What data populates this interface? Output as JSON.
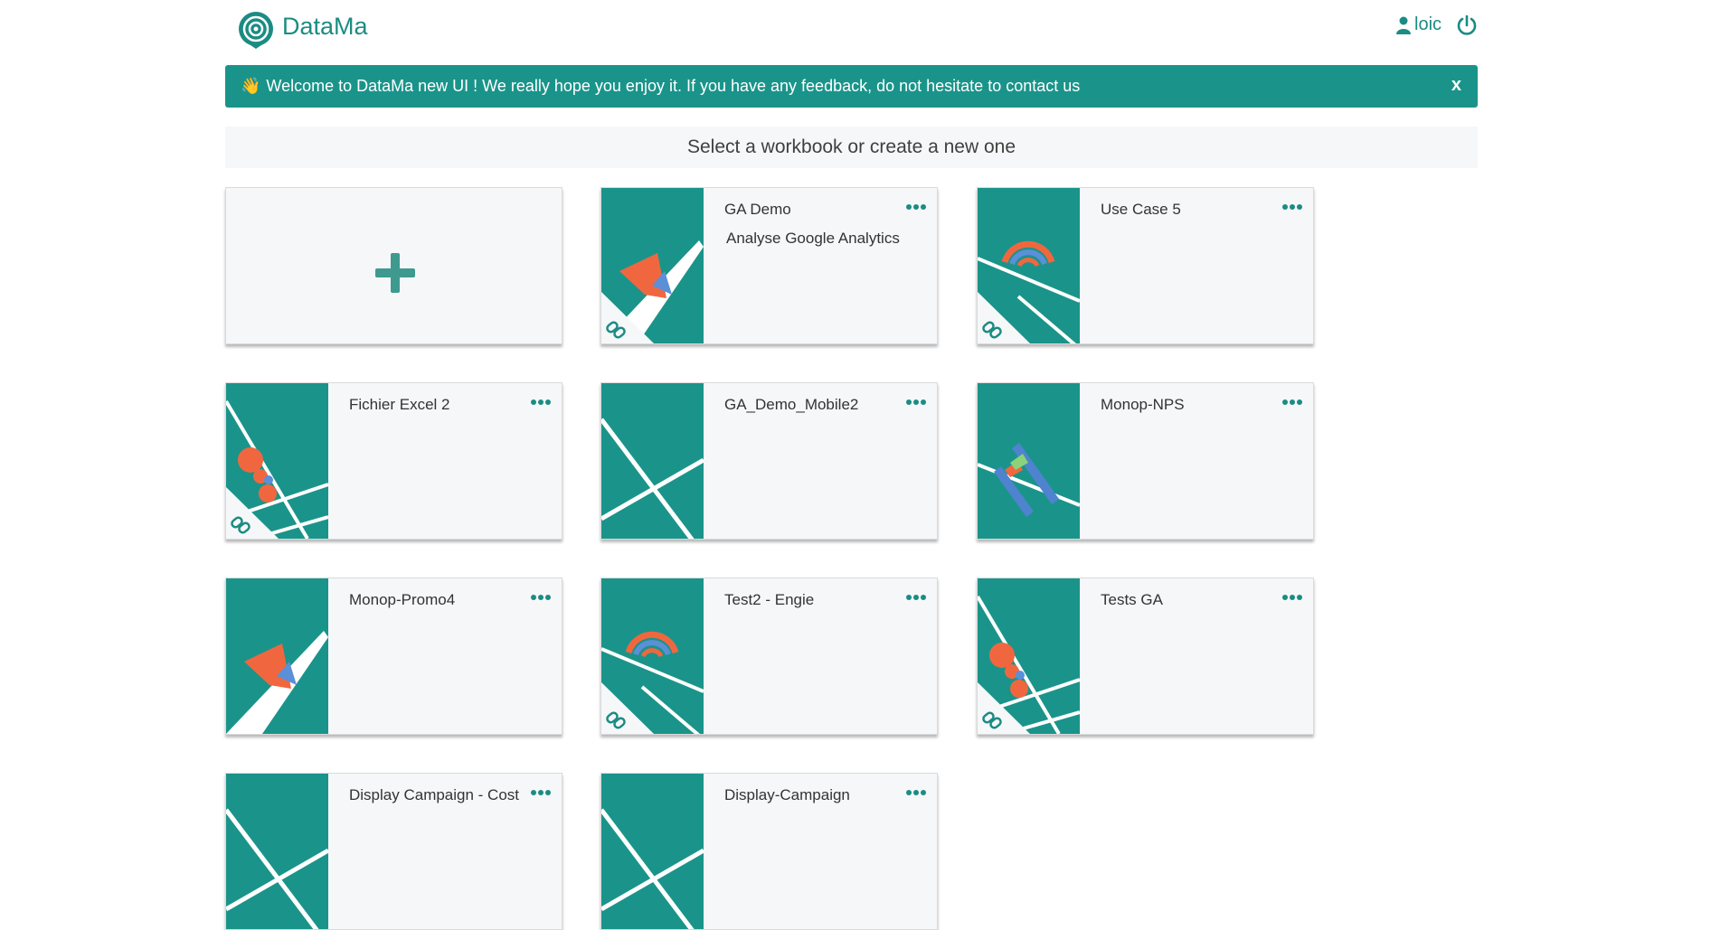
{
  "app": {
    "name": "DataMa"
  },
  "header": {
    "username": "loic"
  },
  "banner": {
    "emoji": "👋",
    "message": "Welcome to DataMa new UI ! We really hope you enjoy it. If you have any feedback, do not hesitate to contact us",
    "close_label": "x"
  },
  "subheader": {
    "text": "Select a workbook or create a new one"
  },
  "colors": {
    "primary": "#1b8c83",
    "thumb_bg": "#1a948a",
    "accent_orange": "#f0673f",
    "accent_blue": "#5b8fd8"
  },
  "workbooks": [
    {
      "name": "GA Demo",
      "description": "Analyse Google Analytics",
      "linked": true,
      "illustration": "funnel-icon"
    },
    {
      "name": "Use Case 5",
      "description": "",
      "linked": true,
      "illustration": "gauge-icon"
    },
    {
      "name": "Fichier Excel 2",
      "description": "",
      "linked": true,
      "illustration": "circles-icon"
    },
    {
      "name": "GA_Demo_Mobile2",
      "description": "",
      "linked": false,
      "illustration": "lines-icon"
    },
    {
      "name": "Monop-NPS",
      "description": "",
      "linked": false,
      "illustration": "bars-icon"
    },
    {
      "name": "Monop-Promo4",
      "description": "",
      "linked": false,
      "illustration": "funnel-icon"
    },
    {
      "name": "Test2 - Engie",
      "description": "",
      "linked": true,
      "illustration": "gauge-icon"
    },
    {
      "name": "Tests GA",
      "description": "",
      "linked": true,
      "illustration": "circles-icon"
    },
    {
      "name": "Display Campaign - Cost",
      "description": "",
      "linked": false,
      "illustration": "lines-icon"
    },
    {
      "name": "Display-Campaign",
      "description": "",
      "linked": false,
      "illustration": "lines-icon"
    }
  ]
}
